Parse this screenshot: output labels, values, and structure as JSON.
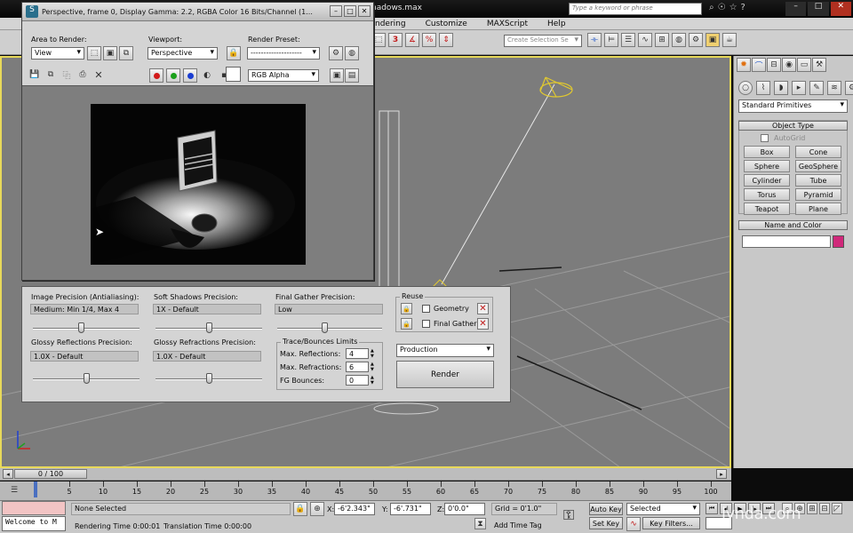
{
  "app": {
    "file_title_fragment": "hadows.max",
    "menu": [
      "ndering",
      "Customize",
      "MAXScript",
      "Help"
    ],
    "search_placeholder": "Type a keyword or phrase",
    "selection_set_placeholder": "Create Selection Se"
  },
  "frame_window": {
    "title": "Perspective, frame 0, Display Gamma: 2.2, RGBA Color 16 Bits/Channel (1...",
    "area_to_render_label": "Area to Render:",
    "area_to_render_value": "View",
    "viewport_label": "Viewport:",
    "viewport_value": "Perspective",
    "render_preset_label": "Render Preset:",
    "render_preset_value": "--------------------",
    "channel_value": "RGB Alpha",
    "colors": {
      "red": "#d21a1a",
      "green": "#1aa01a",
      "blue": "#1a3dd2"
    }
  },
  "render_panel": {
    "image_precision_label": "Image Precision (Antialiasing):",
    "image_precision_value": "Medium: Min 1/4, Max 4",
    "soft_shadows_label": "Soft Shadows Precision:",
    "soft_shadows_value": "1X - Default",
    "final_gather_label": "Final Gather Precision:",
    "final_gather_value": "Low",
    "glossy_reflections_label": "Glossy Reflections Precision:",
    "glossy_reflections_value": "1.0X - Default",
    "glossy_refractions_label": "Glossy Refractions Precision:",
    "glossy_refractions_value": "1.0X - Default",
    "trace_legend": "Trace/Bounces Limits",
    "max_reflections_label": "Max. Reflections:",
    "max_reflections_value": "4",
    "max_refractions_label": "Max. Refractions:",
    "max_refractions_value": "6",
    "fg_bounces_label": "FG Bounces:",
    "fg_bounces_value": "0",
    "reuse_legend": "Reuse",
    "geometry_label": "Geometry",
    "final_gather_reuse_label": "Final Gather",
    "production_value": "Production",
    "render_button": "Render",
    "sliders": {
      "image_precision": 0.45,
      "soft_shadows": 0.5,
      "final_gather": 0.45,
      "glossy_reflections": 0.5,
      "glossy_refractions": 0.5
    }
  },
  "command_panel": {
    "category_value": "Standard Primitives",
    "object_type_title": "Object Type",
    "autogrid_label": "AutoGrid",
    "buttons": [
      "Box",
      "Cone",
      "Sphere",
      "GeoSphere",
      "Cylinder",
      "Tube",
      "Torus",
      "Pyramid",
      "Teapot",
      "Plane"
    ],
    "name_and_color_title": "Name and Color",
    "object_color": "#d0287a"
  },
  "timeline": {
    "frame_counter": "0 / 100",
    "ticks": [
      "0",
      "5",
      "10",
      "15",
      "20",
      "25",
      "30",
      "35",
      "40",
      "45",
      "50",
      "55",
      "60",
      "65",
      "70",
      "75",
      "80",
      "85",
      "90",
      "95",
      "100"
    ]
  },
  "status_bar": {
    "maxscript_text": "Welcome to M",
    "selection_status": "None Selected",
    "rendering_time": "Rendering Time  0:00:01",
    "translation_time": "Translation Time  0:00:00",
    "x_label": "X:",
    "x_value": "-6'2.343\"",
    "y_label": "Y:",
    "y_value": "-6'.731\"",
    "z_label": "Z:",
    "z_value": "0'0.0\"",
    "grid": "Grid = 0'1.0\"",
    "add_time_tag": "Add Time Tag",
    "auto_key": "Auto Key",
    "set_key": "Set Key",
    "key_mode_value": "Selected",
    "key_filters": "Key Filters...",
    "watermark": "lynda.com"
  }
}
